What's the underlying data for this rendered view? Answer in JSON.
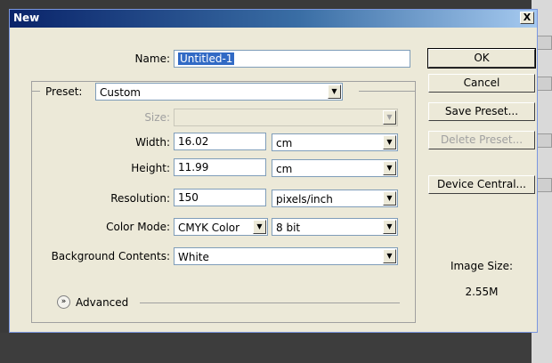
{
  "dialog": {
    "title": "New",
    "close_glyph": "X"
  },
  "name": {
    "label": "Name:",
    "value": "Untitled-1"
  },
  "preset": {
    "label": "Preset:",
    "value": "Custom"
  },
  "size": {
    "label": "Size:",
    "value": ""
  },
  "width": {
    "label": "Width:",
    "value": "16.02",
    "unit": "cm"
  },
  "height": {
    "label": "Height:",
    "value": "11.99",
    "unit": "cm"
  },
  "resolution": {
    "label": "Resolution:",
    "value": "150",
    "unit": "pixels/inch"
  },
  "color_mode": {
    "label": "Color Mode:",
    "value": "CMYK Color",
    "depth": "8 bit"
  },
  "background": {
    "label": "Background Contents:",
    "value": "White"
  },
  "advanced": {
    "label": "Advanced"
  },
  "buttons": {
    "ok": "OK",
    "cancel": "Cancel",
    "save_preset": "Save Preset...",
    "delete_preset": "Delete Preset...",
    "device_central": "Device Central..."
  },
  "image_size": {
    "label": "Image Size:",
    "value": "2.55M"
  }
}
